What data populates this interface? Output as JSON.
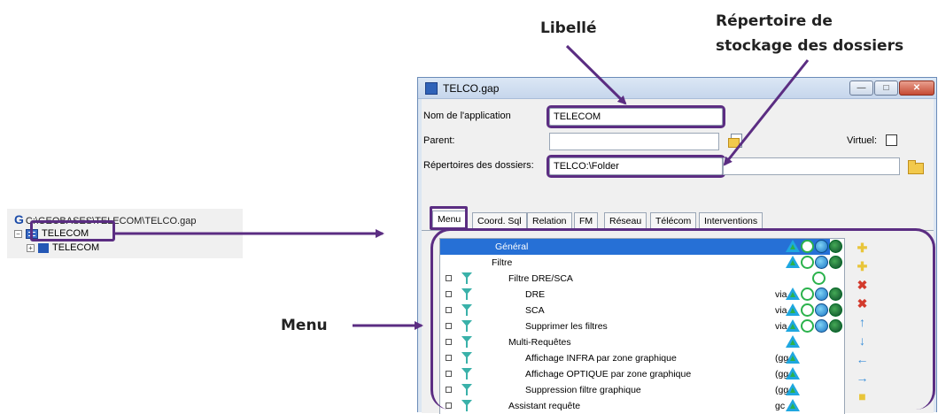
{
  "annotations": {
    "libelle": "Libellé",
    "repertoire_line1": "Répertoire de",
    "repertoire_line2": "stockage des dossiers",
    "menu": "Menu"
  },
  "tree": {
    "path_glyph": "G",
    "path": "C:\\GEOBASES\\TELECOM\\TELCO.gap",
    "root_label": "TELECOM",
    "child_label": "TELECOM"
  },
  "window": {
    "title": "TELCO.gap",
    "min_glyph": "—",
    "max_glyph": "□",
    "close_glyph": "✕"
  },
  "form": {
    "app_name_label": "Nom de l'application",
    "app_name_value": "TELECOM",
    "parent_label": "Parent:",
    "parent_value": "",
    "virtuel_label": "Virtuel:",
    "repertoire_label": "Répertoires des dossiers:",
    "repertoire_value": "TELCO:\\Folder"
  },
  "tabs": [
    {
      "label": "Menu",
      "active": true
    },
    {
      "label": "Coord. Sql"
    },
    {
      "label": "Relation"
    },
    {
      "label": "FM"
    },
    {
      "label": "Réseau"
    },
    {
      "label": "Télécom"
    },
    {
      "label": "Interventions"
    }
  ],
  "menu_rows": [
    {
      "label": "Général",
      "level": 0,
      "selected": true,
      "checkbox": false,
      "funnel": false,
      "suffix": "",
      "icons": [
        "tri",
        "gear",
        "globe",
        "dark"
      ]
    },
    {
      "label": "Filtre",
      "level": 1,
      "checkbox": false,
      "funnel": false,
      "suffix": "",
      "icons": [
        "tri",
        "gear",
        "globe",
        "dark"
      ]
    },
    {
      "label": "Filtre DRE/SCA",
      "level": 2,
      "checkbox": true,
      "funnel": true,
      "suffix": "",
      "icons": [
        "gear"
      ]
    },
    {
      "label": "DRE",
      "level": 3,
      "checkbox": true,
      "funnel": true,
      "suffix": "via",
      "icons": [
        "tri",
        "gear",
        "globe",
        "dark"
      ]
    },
    {
      "label": "SCA",
      "level": 3,
      "checkbox": true,
      "funnel": true,
      "suffix": "via",
      "icons": [
        "tri",
        "gear",
        "globe",
        "dark"
      ]
    },
    {
      "label": "Supprimer les filtres",
      "level": 3,
      "checkbox": true,
      "funnel": true,
      "suffix": "via",
      "icons": [
        "tri",
        "gear",
        "globe",
        "dark"
      ]
    },
    {
      "label": "Multi-Requêtes",
      "level": 2,
      "checkbox": true,
      "funnel": true,
      "suffix": "",
      "icons": [
        "tri"
      ]
    },
    {
      "label": "Affichage INFRA par zone graphique",
      "level": 3,
      "checkbox": true,
      "funnel": true,
      "suffix": "(gg",
      "icons": [
        "tri"
      ]
    },
    {
      "label": "Affichage OPTIQUE par zone graphique",
      "level": 3,
      "checkbox": true,
      "funnel": true,
      "suffix": "(gg",
      "icons": [
        "tri"
      ]
    },
    {
      "label": "Suppression filtre graphique",
      "level": 3,
      "checkbox": true,
      "funnel": true,
      "suffix": "(gg",
      "icons": [
        "tri"
      ]
    },
    {
      "label": "Assistant requête",
      "level": 2,
      "checkbox": true,
      "funnel": true,
      "suffix": "gc",
      "icons": [
        "tri"
      ]
    }
  ],
  "scroll_up_glyph": "^",
  "side_buttons": [
    {
      "name": "add-item",
      "color": "#e8c53a"
    },
    {
      "name": "add-subitem",
      "color": "#e8c53a"
    },
    {
      "name": "delete-item",
      "color": "#d33a2c"
    },
    {
      "name": "delete-all",
      "color": "#d33a2c"
    },
    {
      "name": "move-up",
      "color": "#3a8fd9"
    },
    {
      "name": "move-down",
      "color": "#3a8fd9"
    },
    {
      "name": "move-left",
      "color": "#3a8fd9"
    },
    {
      "name": "move-right",
      "color": "#3a8fd9"
    },
    {
      "name": "extra",
      "color": "#e8c53a"
    }
  ],
  "colors": {
    "highlight": "#5b2d82",
    "selection": "#2670d6"
  }
}
